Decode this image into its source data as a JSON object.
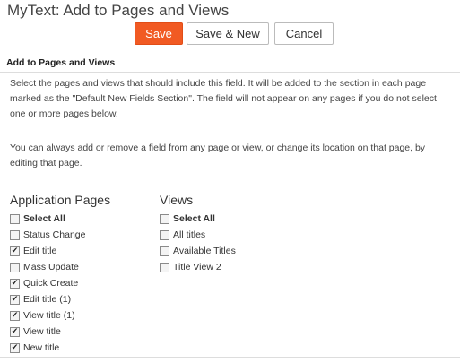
{
  "page": {
    "title": "MyText: Add to Pages and Views"
  },
  "toolbar": {
    "save_label": "Save",
    "save_new_label": "Save & New",
    "cancel_label": "Cancel",
    "save_color": "#f15a23"
  },
  "section": {
    "heading": "Add to Pages and Views",
    "paragraph1": "Select the pages and views that should include this field. It will be added to the section in each page marked as the \"Default New Fields Section\". The field will not appear on any pages if you do not select one or more pages below.",
    "paragraph2": "You can always add or remove a field from any page or view, or change its location on that page, by editing that page."
  },
  "application_pages": {
    "heading": "Application Pages",
    "items": [
      {
        "label": "Select All",
        "checked": false,
        "bold": true
      },
      {
        "label": "Status Change",
        "checked": false,
        "bold": false
      },
      {
        "label": "Edit title",
        "checked": true,
        "bold": false
      },
      {
        "label": "Mass Update",
        "checked": false,
        "bold": false
      },
      {
        "label": "Quick Create",
        "checked": true,
        "bold": false
      },
      {
        "label": "Edit title (1)",
        "checked": true,
        "bold": false
      },
      {
        "label": "View title (1)",
        "checked": true,
        "bold": false
      },
      {
        "label": "View title",
        "checked": true,
        "bold": false
      },
      {
        "label": "New title",
        "checked": true,
        "bold": false
      }
    ]
  },
  "views": {
    "heading": "Views",
    "items": [
      {
        "label": "Select All",
        "checked": false,
        "bold": true
      },
      {
        "label": "All titles",
        "checked": false,
        "bold": false
      },
      {
        "label": "Available Titles",
        "checked": false,
        "bold": false
      },
      {
        "label": "Title View 2",
        "checked": false,
        "bold": false
      }
    ]
  }
}
